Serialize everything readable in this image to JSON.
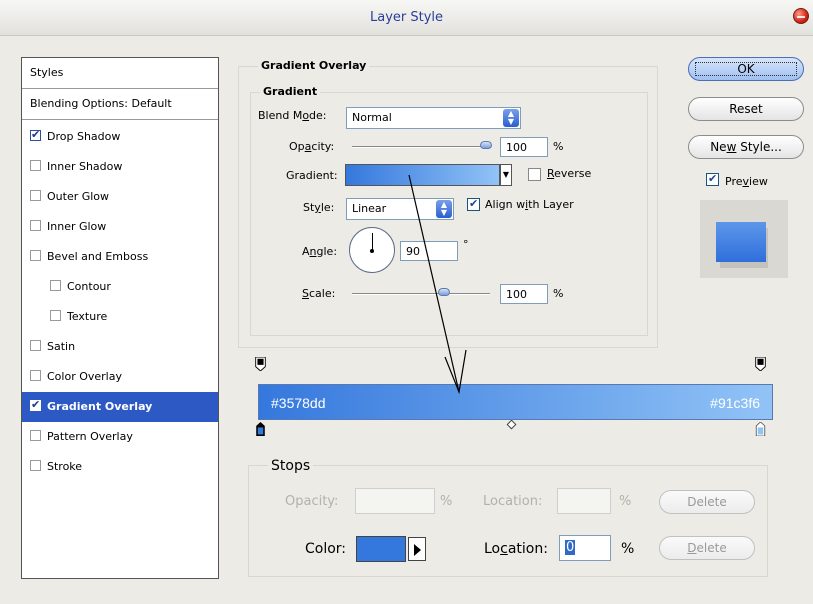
{
  "window": {
    "title": "Layer Style"
  },
  "styles_panel": {
    "header": "Styles",
    "blending_options": "Blending Options: Default",
    "items": [
      {
        "label": "Drop Shadow",
        "checked": true,
        "selected": false,
        "indent": false
      },
      {
        "label": "Inner Shadow",
        "checked": false,
        "selected": false,
        "indent": false
      },
      {
        "label": "Outer Glow",
        "checked": false,
        "selected": false,
        "indent": false
      },
      {
        "label": "Inner Glow",
        "checked": false,
        "selected": false,
        "indent": false
      },
      {
        "label": "Bevel and Emboss",
        "checked": false,
        "selected": false,
        "indent": false
      },
      {
        "label": "Contour",
        "checked": false,
        "selected": false,
        "indent": true
      },
      {
        "label": "Texture",
        "checked": false,
        "selected": false,
        "indent": true
      },
      {
        "label": "Satin",
        "checked": false,
        "selected": false,
        "indent": false
      },
      {
        "label": "Color Overlay",
        "checked": false,
        "selected": false,
        "indent": false
      },
      {
        "label": "Gradient Overlay",
        "checked": true,
        "selected": true,
        "indent": false
      },
      {
        "label": "Pattern Overlay",
        "checked": false,
        "selected": false,
        "indent": false
      },
      {
        "label": "Stroke",
        "checked": false,
        "selected": false,
        "indent": false
      }
    ]
  },
  "gradient_overlay": {
    "section_title": "Gradient Overlay",
    "group_title": "Gradient",
    "blend_mode_label_pre": "Blend M",
    "blend_mode_label_u": "o",
    "blend_mode_label_post": "de:",
    "blend_mode_value": "Normal",
    "opacity_label_pre": "Op",
    "opacity_label_u": "a",
    "opacity_label_post": "city:",
    "opacity_value": "100",
    "opacity_level": 1.0,
    "percent": "%",
    "gradient_label": "Gradient:",
    "reverse_label_pre": "",
    "reverse_label_u": "R",
    "reverse_label_post": "everse",
    "reverse_checked": false,
    "style_label_pre": "St",
    "style_label_u": "y",
    "style_label_post": "le:",
    "style_value": "Linear",
    "align_label_pre": "Align w",
    "align_label_u": "i",
    "align_label_post": "th Layer",
    "align_checked": true,
    "angle_label_pre": "A",
    "angle_label_u": "n",
    "angle_label_post": "gle:",
    "angle_value": "90",
    "degree": "°",
    "scale_label_pre": "",
    "scale_label_u": "S",
    "scale_label_post": "cale:",
    "scale_value": "100",
    "scale_level": 1.0
  },
  "buttons": {
    "ok": "OK",
    "reset": "Reset",
    "new_style_pre": "Ne",
    "new_style_u": "w",
    "new_style_post": " Style...",
    "preview_pre": "Pre",
    "preview_u": "v",
    "preview_post": "iew",
    "preview_checked": true
  },
  "gradient_editor": {
    "left_color": "#3578dd",
    "right_color": "#91c3f6",
    "left_hex_text": "#3578dd",
    "right_hex_text": "#91c3f6",
    "stops_title": "Stops",
    "opacity_label": "Opacity:",
    "location_label": "Location:",
    "percent": "%",
    "delete": "Delete",
    "color_label": "Color:",
    "color_location_label_pre": "Lo",
    "color_location_label_u": "c",
    "color_location_label_post": "ation:",
    "color_location_value": "0",
    "delete2_pre": "",
    "delete2_u": "D",
    "delete2_post": "elete"
  }
}
